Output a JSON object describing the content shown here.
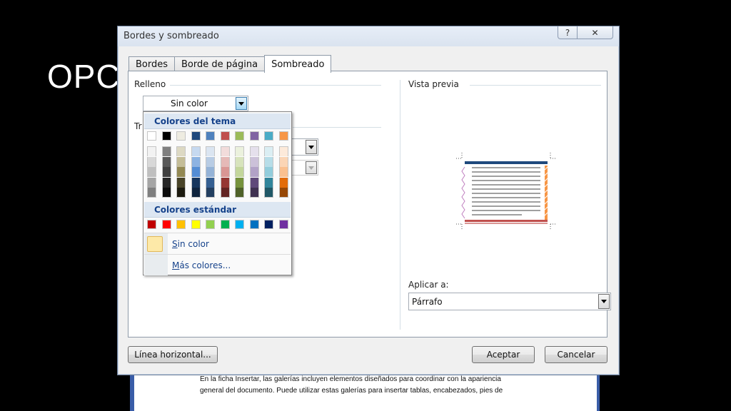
{
  "slide": {
    "title": "OPC"
  },
  "document": {
    "line1": "En la ficha Insertar, las galerías incluyen elementos diseñados para coordinar con la apariencia",
    "line2": "general del documento. Puede utilizar estas galerías para insertar tablas, encabezados, pies de"
  },
  "dialog": {
    "title": "Bordes y sombreado",
    "help_label": "?",
    "close_label": "✕",
    "tabs": [
      "Bordes",
      "Borde de página",
      "Sombreado"
    ],
    "active_tab": "Sombreado",
    "fill_label": "Relleno",
    "fill_value": "Sin color",
    "pattern_label_partial": "Tr",
    "preview_label": "Vista previa",
    "apply_to_label": "Aplicar a:",
    "apply_to_value": "Párrafo",
    "horizontal_line_button": "Línea horizontal...",
    "ok_button": "Aceptar",
    "cancel_button": "Cancelar"
  },
  "color_picker": {
    "theme_header": "Colores del tema",
    "standard_header": "Colores estándar",
    "no_color_label": "Sin color",
    "more_colors_label": "Más colores...",
    "theme_colors": [
      "#ffffff",
      "#000000",
      "#eeece1",
      "#1f497d",
      "#4f81bd",
      "#c0504d",
      "#9bbb59",
      "#8064a2",
      "#4bacc6",
      "#f79646"
    ],
    "theme_shades": [
      [
        "#f2f2f2",
        "#d8d8d8",
        "#bfbfbf",
        "#a5a5a5",
        "#7f7f7f"
      ],
      [
        "#7f7f7f",
        "#595959",
        "#3f3f3f",
        "#262626",
        "#0c0c0c"
      ],
      [
        "#ddd9c3",
        "#c4bd97",
        "#938953",
        "#494429",
        "#1d1b10"
      ],
      [
        "#c6d9f0",
        "#8db3e2",
        "#548dd4",
        "#17365d",
        "#0f243e"
      ],
      [
        "#dbe5f1",
        "#b8cce4",
        "#95b3d7",
        "#366092",
        "#244061"
      ],
      [
        "#f2dcdb",
        "#e5b9b7",
        "#d99694",
        "#953734",
        "#632423"
      ],
      [
        "#ebf1dd",
        "#d7e3bc",
        "#c3d69b",
        "#76923c",
        "#4f6128"
      ],
      [
        "#e5e0ec",
        "#ccc1d9",
        "#b2a2c7",
        "#5f497a",
        "#3f3151"
      ],
      [
        "#dbeef3",
        "#b7dde8",
        "#92cddc",
        "#31859b",
        "#205867"
      ],
      [
        "#fdeada",
        "#fbd5b5",
        "#fac08f",
        "#e36c09",
        "#974806"
      ]
    ],
    "standard_colors": [
      "#c00000",
      "#ff0000",
      "#ffc000",
      "#ffff00",
      "#92d050",
      "#00b050",
      "#00b0f0",
      "#0070c0",
      "#002060",
      "#7030a0"
    ]
  }
}
